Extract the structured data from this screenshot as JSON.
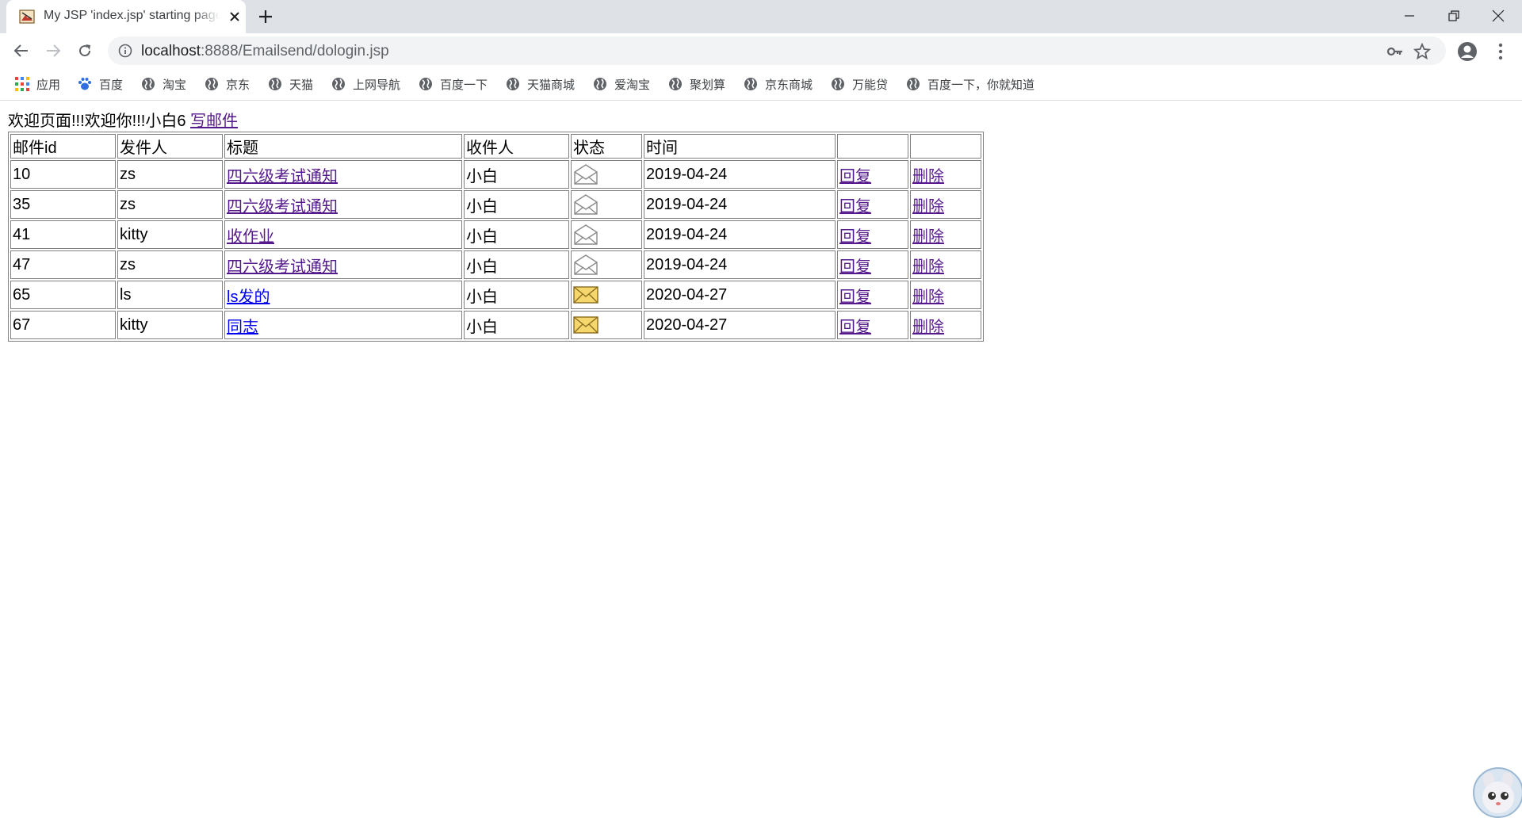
{
  "browser": {
    "tab_title": "My JSP 'index.jsp' starting page",
    "url_host": "localhost",
    "url_path": ":8888/Emailsend/dologin.jsp"
  },
  "bookmarks": [
    {
      "label": "应用",
      "icon": "apps-grid-icon"
    },
    {
      "label": "百度",
      "icon": "baidu-paw-icon"
    },
    {
      "label": "淘宝",
      "icon": "globe-icon"
    },
    {
      "label": "京东",
      "icon": "globe-icon"
    },
    {
      "label": "天猫",
      "icon": "globe-icon"
    },
    {
      "label": "上网导航",
      "icon": "globe-icon"
    },
    {
      "label": "百度一下",
      "icon": "globe-icon"
    },
    {
      "label": "天猫商城",
      "icon": "globe-icon"
    },
    {
      "label": "爱淘宝",
      "icon": "globe-icon"
    },
    {
      "label": "聚划算",
      "icon": "globe-icon"
    },
    {
      "label": "京东商城",
      "icon": "globe-icon"
    },
    {
      "label": "万能贷",
      "icon": "globe-icon"
    },
    {
      "label": "百度一下，你就知道",
      "icon": "globe-icon"
    }
  ],
  "page": {
    "welcome_text": "欢迎页面!!!欢迎你!!!小白6",
    "write_link": "写邮件",
    "columns": [
      "邮件id",
      "发件人",
      "标题",
      "收件人",
      "状态",
      "时间",
      "",
      ""
    ],
    "rows": [
      {
        "id": "10",
        "sender": "zs",
        "title": "四六级考试通知",
        "receiver": "小白",
        "status": "read",
        "time": "2019-04-24",
        "reply": "回复",
        "delete": "删除"
      },
      {
        "id": "35",
        "sender": "zs",
        "title": "四六级考试通知",
        "receiver": "小白",
        "status": "read",
        "time": "2019-04-24",
        "reply": "回复",
        "delete": "删除"
      },
      {
        "id": "41",
        "sender": "kitty",
        "title": "收作业",
        "receiver": "小白",
        "status": "read",
        "time": "2019-04-24",
        "reply": "回复",
        "delete": "删除"
      },
      {
        "id": "47",
        "sender": "zs",
        "title": "四六级考试通知",
        "receiver": "小白",
        "status": "read",
        "time": "2019-04-24",
        "reply": "回复",
        "delete": "删除"
      },
      {
        "id": "65",
        "sender": "ls",
        "title": "ls发的",
        "receiver": "小白",
        "status": "unread",
        "time": "2020-04-27",
        "reply": "回复",
        "delete": "删除"
      },
      {
        "id": "67",
        "sender": "kitty",
        "title": "同志",
        "receiver": "小白",
        "status": "unread",
        "time": "2020-04-27",
        "reply": "回复",
        "delete": "删除"
      }
    ]
  },
  "colors": {
    "visited_link": "#551a8b",
    "unvisited_link": "#0000ee",
    "unread_envelope": "#f5d76e",
    "read_envelope": "#ffffff"
  }
}
